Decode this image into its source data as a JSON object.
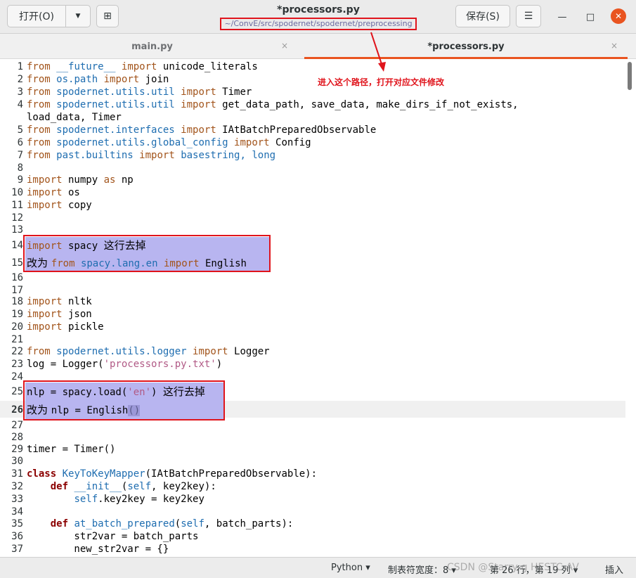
{
  "header": {
    "open_label": "打开(O)",
    "open_menu_icon": "▼",
    "new_tab_icon": "⊞",
    "title": "*processors.py",
    "subtitle": "~/ConvE/src/spodernet/spodernet/preprocessing",
    "save_label": "保存(S)",
    "menu_icon": "☰",
    "minimize_icon": "—",
    "maximize_icon": "□",
    "close_icon": "✕"
  },
  "tabs": [
    {
      "label": "main.py",
      "close": "×"
    },
    {
      "label": "*processors.py",
      "close": "×"
    }
  ],
  "annotation": "进入这个路径，打开对应文件修改",
  "lines": [
    {
      "n": "1"
    },
    {
      "n": "2"
    },
    {
      "n": "3"
    },
    {
      "n": "4"
    },
    {
      "n": "5"
    },
    {
      "n": "6"
    },
    {
      "n": "7"
    },
    {
      "n": "8"
    },
    {
      "n": "9"
    },
    {
      "n": "10"
    },
    {
      "n": "11"
    },
    {
      "n": "12"
    },
    {
      "n": "13"
    },
    {
      "n": "14"
    },
    {
      "n": "15"
    },
    {
      "n": "16"
    },
    {
      "n": "17"
    },
    {
      "n": "18"
    },
    {
      "n": "19"
    },
    {
      "n": "20"
    },
    {
      "n": "21"
    },
    {
      "n": "22"
    },
    {
      "n": "23"
    },
    {
      "n": "24"
    },
    {
      "n": "25"
    },
    {
      "n": "26"
    },
    {
      "n": "27"
    },
    {
      "n": "28"
    },
    {
      "n": "29"
    },
    {
      "n": "30"
    },
    {
      "n": "31"
    },
    {
      "n": "32"
    },
    {
      "n": "33"
    },
    {
      "n": "34"
    },
    {
      "n": "35"
    },
    {
      "n": "36"
    },
    {
      "n": "37"
    }
  ],
  "code": {
    "l1": [
      "from",
      " ",
      "__future__",
      " ",
      "import",
      " unicode_literals"
    ],
    "l2": [
      "from",
      " ",
      "os.path",
      " ",
      "import",
      " join"
    ],
    "l3": [
      "from",
      " ",
      "spodernet.utils.util",
      " ",
      "import",
      " Timer"
    ],
    "l4": [
      "from",
      " ",
      "spodernet.utils.util",
      " ",
      "import",
      " get_data_path, save_data, make_dirs_if_not_exists,"
    ],
    "l4b": "load_data, Timer",
    "l5": [
      "from",
      " ",
      "spodernet.interfaces",
      " ",
      "import",
      " IAtBatchPreparedObservable"
    ],
    "l6": [
      "from",
      " ",
      "spodernet.utils.global_config",
      " ",
      "import",
      " Config"
    ],
    "l7": [
      "from",
      " ",
      "past.builtins",
      " ",
      "import",
      " ",
      "basestring, long"
    ],
    "l9": [
      "import",
      " numpy ",
      "as",
      " np"
    ],
    "l10": [
      "import",
      " os"
    ],
    "l11": [
      "import",
      " copy"
    ],
    "l14": [
      "import",
      " spacy ",
      "这行去掉"
    ],
    "l15": [
      "改为 ",
      "from",
      " ",
      "spacy.lang.en",
      " ",
      "import",
      " English"
    ],
    "l18": [
      "import",
      " nltk"
    ],
    "l19": [
      "import",
      " json"
    ],
    "l20": [
      "import",
      " pickle"
    ],
    "l22": [
      "from",
      " ",
      "spodernet.utils.logger",
      " ",
      "import",
      " Logger"
    ],
    "l23": [
      "log = Logger(",
      "'processors.py.txt'",
      ")"
    ],
    "l25": [
      "nlp = spacy.load(",
      "'en'",
      ") ",
      "这行去掉"
    ],
    "l26": [
      "改为 ",
      "nlp = English",
      "()"
    ],
    "l29": "timer = Timer()",
    "l31": [
      "class",
      " ",
      "KeyToKeyMapper",
      "(IAtBatchPreparedObservable):"
    ],
    "l32": [
      "    ",
      "def",
      " ",
      "__init__",
      "(",
      "self",
      ", key2key):"
    ],
    "l33": [
      "        ",
      "self",
      ".key2key = key2key"
    ],
    "l35": [
      "    ",
      "def",
      " ",
      "at_batch_prepared",
      "(",
      "self",
      ", batch_parts):"
    ],
    "l36": "        str2var = batch_parts",
    "l37": "        new_str2var = {}"
  },
  "status": {
    "language": "Python ▾",
    "tab_width": "制表符宽度：8 ▾",
    "position": "第 26 行，第 19 列 ▾",
    "mode": "插入",
    "watermark": "CSDN @Starry-g HESTC-AV"
  },
  "colors": {
    "accent": "#e95420",
    "annotation_red": "#e0141c",
    "selection": "#b8b5f0"
  }
}
